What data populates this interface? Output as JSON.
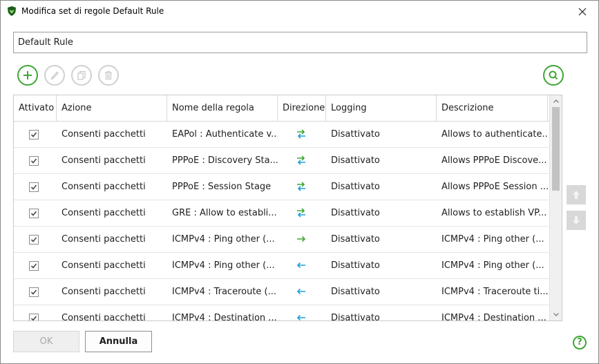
{
  "window": {
    "title": "Modifica set di regole Default Rule"
  },
  "ruleset_name": {
    "value": "Default Rule"
  },
  "toolbar": {
    "add_icon": "plus-icon",
    "edit_icon": "pencil-icon",
    "copy_icon": "copy-icon",
    "delete_icon": "trash-icon",
    "search_icon": "search-icon"
  },
  "columns": [
    "Attivato",
    "Azione",
    "Nome della regola",
    "Direzione",
    "Logging",
    "Descrizione"
  ],
  "rows": [
    {
      "enabled": true,
      "action": "Consenti pacchetti",
      "name": "EAPol : Authenticate v...",
      "direction": "both",
      "logging": "Disattivato",
      "description": "Allows to authenticate..."
    },
    {
      "enabled": true,
      "action": "Consenti pacchetti",
      "name": "PPPoE : Discovery Sta...",
      "direction": "both",
      "logging": "Disattivato",
      "description": "Allows PPPoE Discove..."
    },
    {
      "enabled": true,
      "action": "Consenti pacchetti",
      "name": "PPPoE : Session Stage",
      "direction": "both",
      "logging": "Disattivato",
      "description": "Allows PPPoE Session ..."
    },
    {
      "enabled": true,
      "action": "Consenti pacchetti",
      "name": "GRE : Allow to establi...",
      "direction": "both",
      "logging": "Disattivato",
      "description": "Allows to establish VP..."
    },
    {
      "enabled": true,
      "action": "Consenti pacchetti",
      "name": "ICMPv4 : Ping other (...",
      "direction": "out",
      "logging": "Disattivato",
      "description": "ICMPv4 : Ping other (..."
    },
    {
      "enabled": true,
      "action": "Consenti pacchetti",
      "name": "ICMPv4 : Ping other (...",
      "direction": "in",
      "logging": "Disattivato",
      "description": "ICMPv4 : Ping other (..."
    },
    {
      "enabled": true,
      "action": "Consenti pacchetti",
      "name": "ICMPv4 : Traceroute (...",
      "direction": "in",
      "logging": "Disattivato",
      "description": "ICMPv4 : Traceroute ti..."
    },
    {
      "enabled": true,
      "action": "Consenti pacchetti",
      "name": "ICMPv4 : Destination ...",
      "direction": "in",
      "logging": "Disattivato",
      "description": "ICMPv4 : Destination ..."
    }
  ],
  "buttons": {
    "ok": "OK",
    "cancel": "Annulla",
    "help": "?"
  },
  "colors": {
    "accent_green": "#3fa535",
    "arrow_green": "#3fa535",
    "arrow_blue": "#1aa0d8",
    "disabled_gray": "#d0d0d0"
  }
}
